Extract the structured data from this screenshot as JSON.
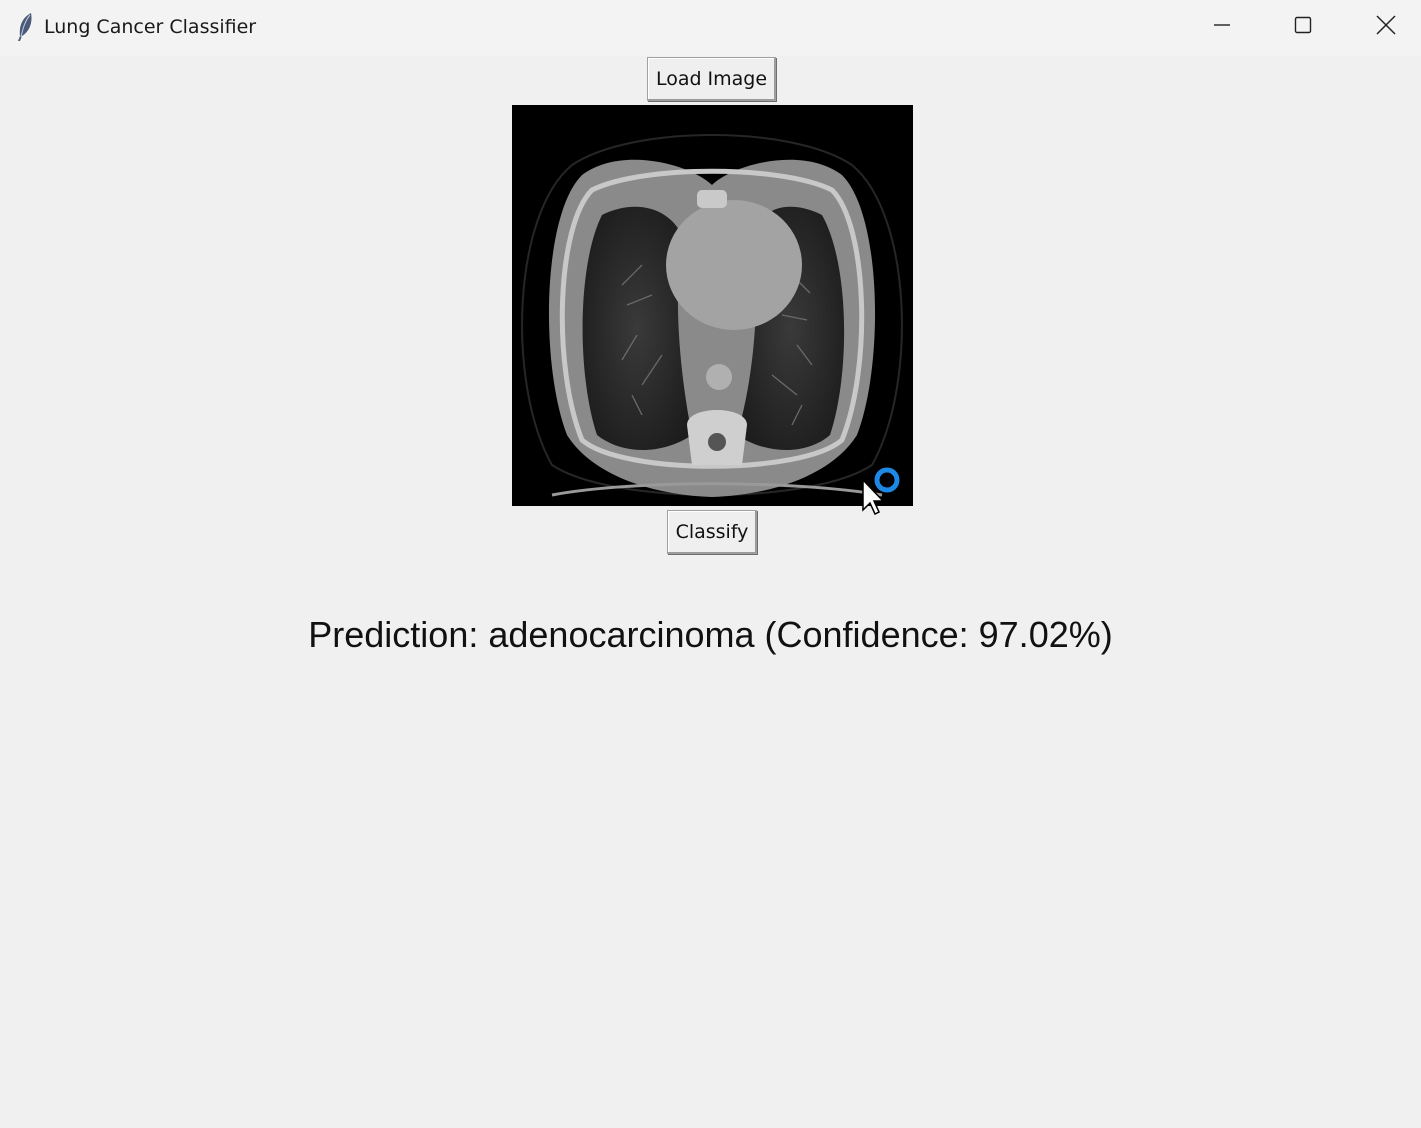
{
  "window": {
    "title": "Lung Cancer Classifier",
    "icon": "feather-icon",
    "controls": [
      "minimize-icon",
      "maximize-icon",
      "close-icon"
    ]
  },
  "toolbar": {
    "load_label": "Load Image",
    "classify_label": "Classify"
  },
  "scan": {
    "content": "chest CT axial scan image"
  },
  "result": {
    "text": "Prediction: adenocarcinoma (Confidence: 97.02%)"
  },
  "colors": {
    "background": "#f0f0f0",
    "busy_cursor_ring": "#1e88e5"
  }
}
